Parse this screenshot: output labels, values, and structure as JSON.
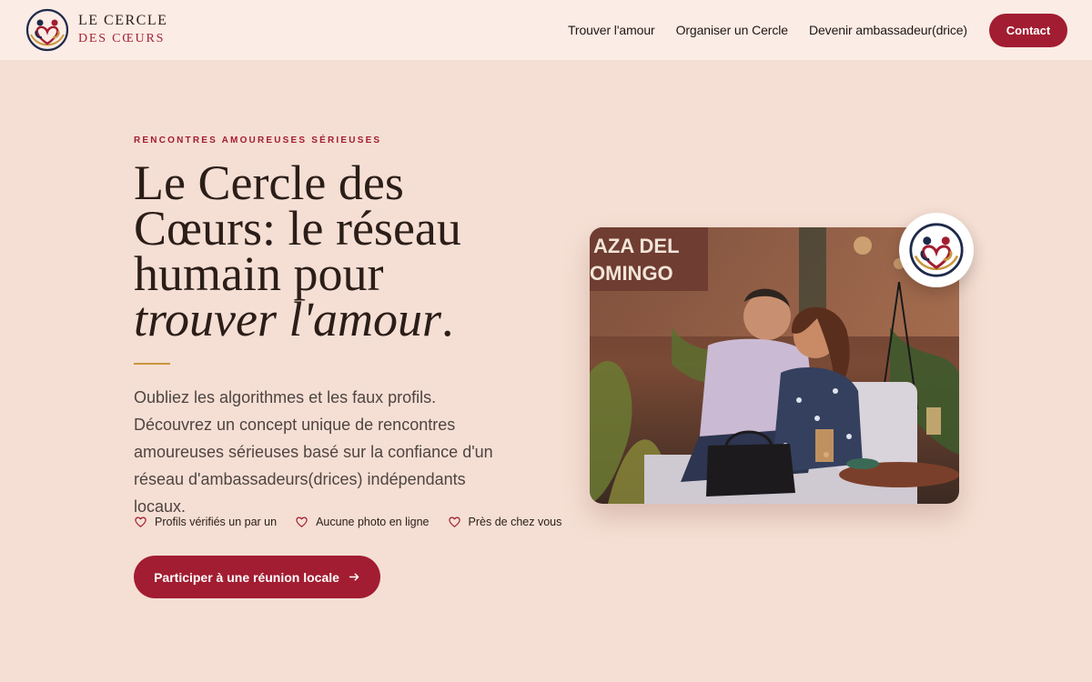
{
  "brand": {
    "name_line1": "LE CERCLE",
    "name_line2": "DES CŒURS",
    "primary_color": "#a21d31",
    "gold_color": "#c9963f",
    "navy_color": "#1f2a4a"
  },
  "nav": {
    "items": [
      {
        "label": "Trouver l'amour"
      },
      {
        "label": "Organiser un Cercle"
      },
      {
        "label": "Devenir ambassadeur(drice)"
      }
    ],
    "contact_label": "Contact"
  },
  "hero": {
    "eyebrow": "RENCONTRES AMOUREUSES SÉRIEUSES",
    "headline_line1": "Le Cercle des",
    "headline_line2": "Cœurs: le réseau",
    "headline_line3": "humain pour",
    "headline_emphasis": "trouver l'amour",
    "headline_end": ".",
    "lead": "Oubliez les algorithmes et les faux profils. Découvrez un concept unique de rencontres amoureuses sérieuses basé sur la confiance d'un réseau d'ambassadeurs(drices) indépendants locaux.",
    "features": [
      {
        "icon": "heart-outline-icon",
        "label": "Profils vérifiés un par un"
      },
      {
        "icon": "heart-outline-icon",
        "label": "Aucune photo en ligne"
      },
      {
        "icon": "heart-outline-icon",
        "label": "Près de chez vous"
      }
    ],
    "cta_label": "Participer à une réunion locale",
    "cta_icon": "arrow-right-icon"
  },
  "photo": {
    "sign_text_line1": "AZA DEL",
    "sign_text_line2": "OMINGO"
  }
}
